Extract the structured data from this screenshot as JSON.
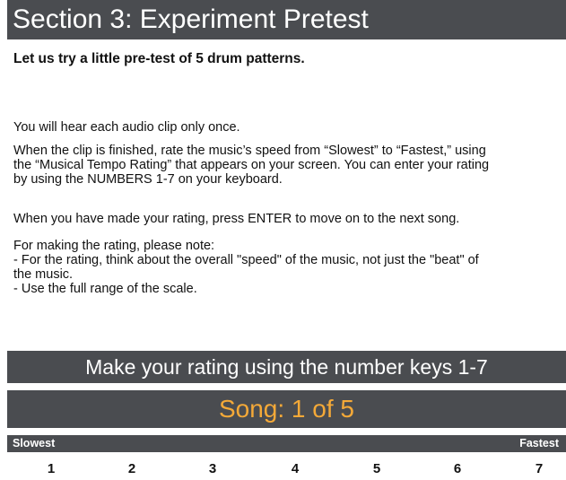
{
  "header": {
    "title": "Section 3: Experiment Pretest"
  },
  "intro": {
    "bold_text": "Let us try a little pre-test of 5 drum patterns."
  },
  "instructions": {
    "line1": "You will hear each audio clip only once.",
    "para2": [
      "When the clip is finished, rate the music’s speed from “Slowest” to “Fastest,” using",
      "the “Musical Tempo Rating” that appears on your screen. You can enter your rating",
      "by using the NUMBERS 1-7 on your keyboard."
    ],
    "line3": "When you have made your rating, press ENTER to move on to the next song.",
    "notes": [
      "For making the rating, please note:",
      "- For the rating, think about the overall \"speed\" of the music, not just the \"beat\" of",
      "the music.",
      "- Use the full range of the scale."
    ]
  },
  "rating_bar": {
    "label": "Make your rating using the number keys 1-7"
  },
  "song_bar": {
    "label": "Song: 1 of 5"
  },
  "scale": {
    "low_label": "Slowest",
    "high_label": "Fastest",
    "numbers": [
      "1",
      "2",
      "3",
      "4",
      "5",
      "6",
      "7"
    ]
  },
  "colors": {
    "bar_background": "#4a4c50",
    "bar_text": "#ffffff",
    "song_text": "#f4a938",
    "body_text": "#111111"
  }
}
